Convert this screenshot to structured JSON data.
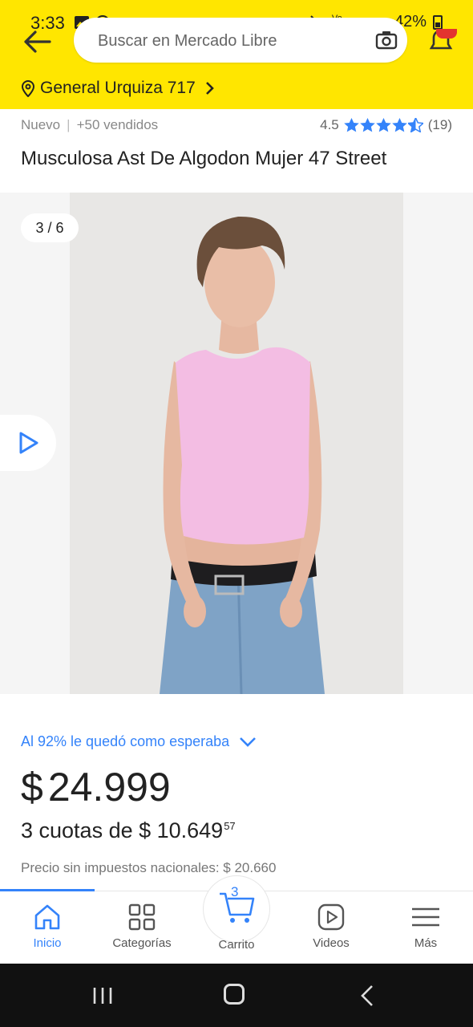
{
  "status_bar": {
    "time": "3:33",
    "battery": "42%",
    "network": "4G"
  },
  "header": {
    "search_placeholder": "Buscar en Mercado Libre",
    "location": "General Urquiza 717"
  },
  "product": {
    "condition": "Nuevo",
    "sold": "+50 vendidos",
    "rating": "4.5",
    "reviews": "(19)",
    "stars_filled": 4.5,
    "title": "Musculosa Ast De Algodon Mujer 47 Street",
    "image_counter": "3 / 6",
    "satisfaction": "Al 92% le quedó como esperaba",
    "price_currency": "$",
    "price": "24.999",
    "installments_text": "3 cuotas de $ 10.649",
    "installments_cents": "57",
    "taxes": "Precio sin impuestos nacionales: $ 20.660"
  },
  "bottom_nav": {
    "items": [
      {
        "label": "Inicio"
      },
      {
        "label": "Categorías"
      },
      {
        "label": "Carrito"
      },
      {
        "label": "Videos"
      },
      {
        "label": "Más"
      }
    ],
    "cart_count": "3"
  },
  "colors": {
    "brand_yellow": "#FFE600",
    "accent_blue": "#3483FA"
  }
}
